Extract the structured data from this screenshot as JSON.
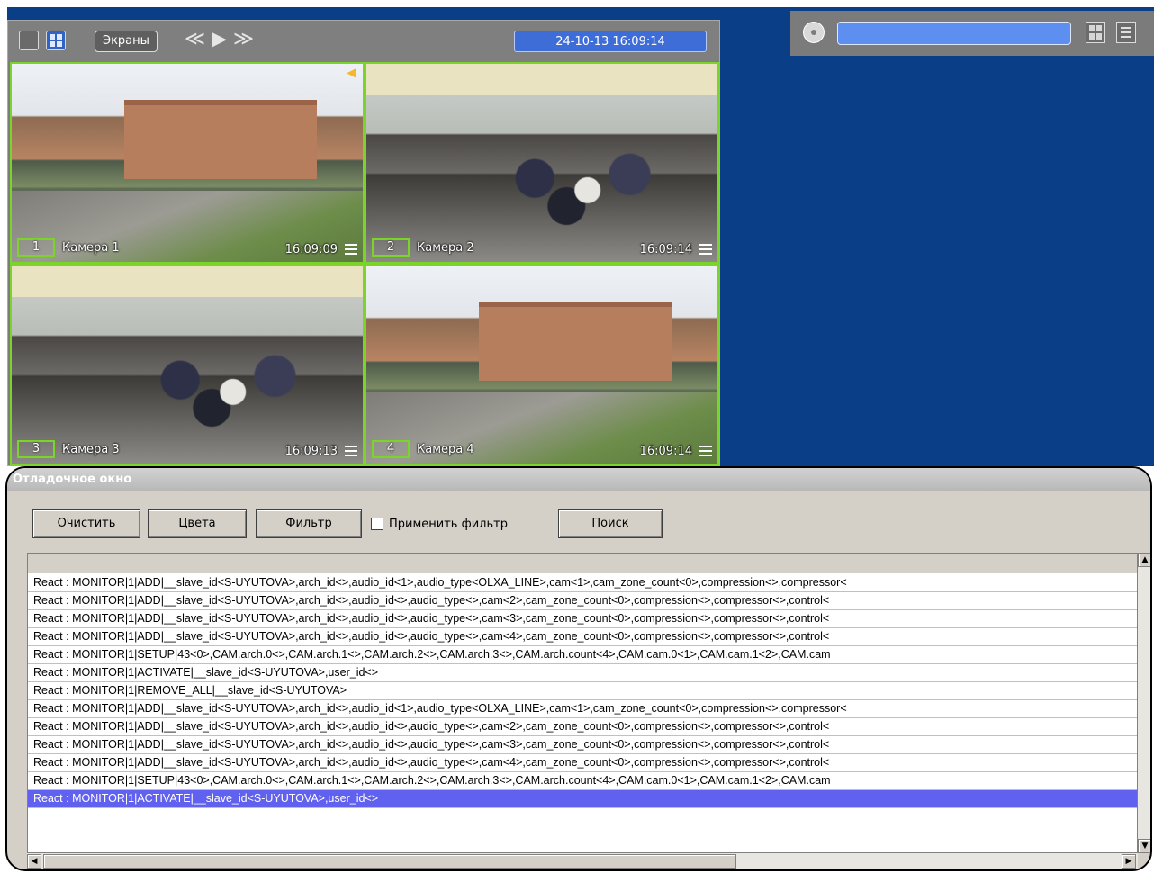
{
  "monitor": {
    "screens_label": "Экраны",
    "nav_prev": "≪",
    "nav_play": "▶",
    "nav_next": "≫",
    "datetime": "24-10-13  16:09:14",
    "tiles": [
      {
        "num": "1",
        "name": "Камера 1",
        "time": "16:09:09"
      },
      {
        "num": "2",
        "name": "Камера 2",
        "time": "16:09:14"
      },
      {
        "num": "3",
        "name": "Камера 3",
        "time": "16:09:13"
      },
      {
        "num": "4",
        "name": "Камера 4",
        "time": "16:09:14"
      }
    ]
  },
  "debug": {
    "title": "Отладочное окно",
    "buttons": {
      "clear": "Очистить",
      "colors": "Цвета",
      "filter": "Фильтр",
      "search": "Поиск"
    },
    "apply_filter_label": "Применить фильтр",
    "log_rows": [
      "React : MONITOR|1|ADD|__slave_id<S-UYUTOVA>,arch_id<>,audio_id<1>,audio_type<OLXA_LINE>,cam<1>,cam_zone_count<0>,compression<>,compressor<",
      "React : MONITOR|1|ADD|__slave_id<S-UYUTOVA>,arch_id<>,audio_id<>,audio_type<>,cam<2>,cam_zone_count<0>,compression<>,compressor<>,control<",
      "React : MONITOR|1|ADD|__slave_id<S-UYUTOVA>,arch_id<>,audio_id<>,audio_type<>,cam<3>,cam_zone_count<0>,compression<>,compressor<>,control<",
      "React : MONITOR|1|ADD|__slave_id<S-UYUTOVA>,arch_id<>,audio_id<>,audio_type<>,cam<4>,cam_zone_count<0>,compression<>,compressor<>,control<",
      "React : MONITOR|1|SETUP|43<0>,CAM.arch.0<>,CAM.arch.1<>,CAM.arch.2<>,CAM.arch.3<>,CAM.arch.count<4>,CAM.cam.0<1>,CAM.cam.1<2>,CAM.cam",
      "React : MONITOR|1|ACTIVATE|__slave_id<S-UYUTOVA>,user_id<>",
      "React : MONITOR|1|REMOVE_ALL|__slave_id<S-UYUTOVA>",
      "React : MONITOR|1|ADD|__slave_id<S-UYUTOVA>,arch_id<>,audio_id<1>,audio_type<OLXA_LINE>,cam<1>,cam_zone_count<0>,compression<>,compressor<",
      "React : MONITOR|1|ADD|__slave_id<S-UYUTOVA>,arch_id<>,audio_id<>,audio_type<>,cam<2>,cam_zone_count<0>,compression<>,compressor<>,control<",
      "React : MONITOR|1|ADD|__slave_id<S-UYUTOVA>,arch_id<>,audio_id<>,audio_type<>,cam<3>,cam_zone_count<0>,compression<>,compressor<>,control<",
      "React : MONITOR|1|ADD|__slave_id<S-UYUTOVA>,arch_id<>,audio_id<>,audio_type<>,cam<4>,cam_zone_count<0>,compression<>,compressor<>,control<",
      "React : MONITOR|1|SETUP|43<0>,CAM.arch.0<>,CAM.arch.1<>,CAM.arch.2<>,CAM.arch.3<>,CAM.arch.count<4>,CAM.cam.0<1>,CAM.cam.1<2>,CAM.cam",
      "React : MONITOR|1|ACTIVATE|__slave_id<S-UYUTOVA>,user_id<>"
    ],
    "selected_row": 12
  },
  "colors": {
    "desktop": "#0a3e86",
    "tile_border": "#7cd42b",
    "datetime_bg": "#3e6dd8",
    "selection": "#6161ef"
  },
  "icons": [
    "single-view-icon",
    "grid-view-icon",
    "speaker-icon",
    "menu-icon",
    "ptz-icon",
    "layout-grid-icon",
    "list-icon",
    "scroll-up-icon",
    "scroll-down-icon",
    "scroll-left-icon",
    "scroll-right-icon"
  ]
}
